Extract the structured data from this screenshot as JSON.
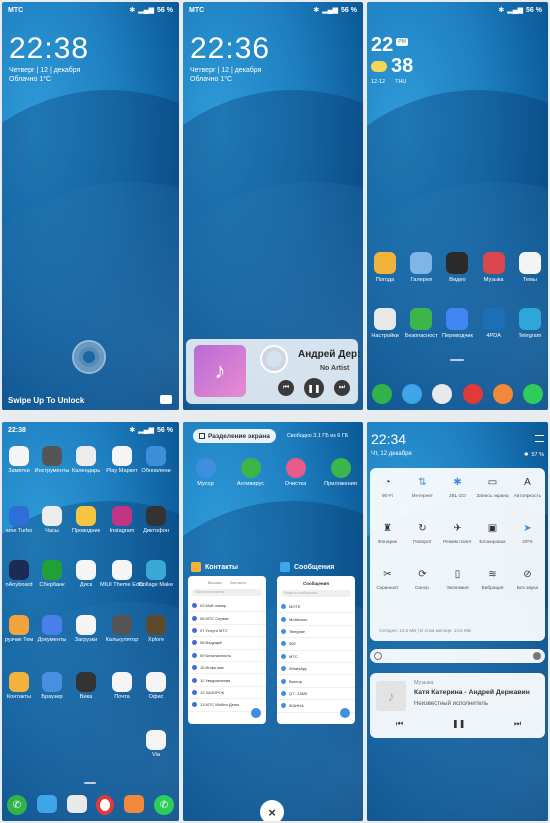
{
  "p1": {
    "carrier": "МТС",
    "battery": "56 %",
    "time": "22:38",
    "date": "Четверг | 12 | декабря",
    "weather": "Облачно 1°C",
    "hint": "Swipe Up To Unlock"
  },
  "p2": {
    "carrier": "МТС",
    "battery": "56 %",
    "time": "22:36",
    "date": "Четверг | 12 | декабря",
    "weather": "Облачно 1°C",
    "music_title": "Андрей Дер:",
    "music_artist": "No Artist"
  },
  "p3": {
    "battery": "56 %",
    "clock_h": "22",
    "clock_ampm": "PM",
    "clock_m": "38",
    "date": "12-12",
    "day": "THU",
    "row1": [
      {
        "label": "Погода",
        "icon": "weather-icon",
        "color": "#f2b33c"
      },
      {
        "label": "Галерея",
        "icon": "gallery-icon",
        "color": "#7fb6e8"
      },
      {
        "label": "Видео",
        "icon": "video-icon",
        "color": "#2a2a2a"
      },
      {
        "label": "Музыка",
        "icon": "music-icon",
        "color": "#d9464c"
      },
      {
        "label": "Темы",
        "icon": "themes-icon",
        "color": "#f4f4f4"
      }
    ],
    "row2": [
      {
        "label": "Настройки",
        "icon": "settings-icon",
        "color": "#e8e8e8"
      },
      {
        "label": "Безопасност",
        "icon": "security-icon",
        "color": "#3cb54a"
      },
      {
        "label": "Переводчик",
        "icon": "translate-icon",
        "color": "#4285f4"
      },
      {
        "label": "4PDA",
        "icon": "4pda-icon",
        "color": "#1b6fb5"
      },
      {
        "label": "Telegram",
        "icon": "telegram-icon",
        "color": "#2ea6da"
      }
    ],
    "dock": [
      {
        "icon": "phone-icon",
        "color": "#32b34a"
      },
      {
        "icon": "messages-icon",
        "color": "#3da5e8"
      },
      {
        "icon": "camera-icon",
        "color": "#e9e9e9"
      },
      {
        "icon": "opera-icon",
        "color": "#e03a3a"
      },
      {
        "icon": "mi-icon",
        "color": "#f2883a"
      },
      {
        "icon": "whatsapp-icon",
        "color": "#2ecc5b"
      }
    ]
  },
  "p4": {
    "time": "22:38",
    "battery": "56 %",
    "apps": [
      {
        "label": "Заметки",
        "color": "#f5f5f5"
      },
      {
        "label": "Инструменты",
        "color": "#555"
      },
      {
        "label": "Календарь",
        "color": "#ececec"
      },
      {
        "label": "Play Маркет",
        "color": "#f5f5f5"
      },
      {
        "label": "Обновлени",
        "color": "#3d8fd9"
      },
      {
        "label": "ame Turbo",
        "color": "#2d6fd6"
      },
      {
        "label": "Часы",
        "color": "#ececec"
      },
      {
        "label": "Проводник",
        "color": "#f5c440"
      },
      {
        "label": "Instagram",
        "color": "#c13584"
      },
      {
        "label": "Диктофон",
        "color": "#333"
      },
      {
        "label": "nAnyboard",
        "color": "#1d2a55"
      },
      {
        "label": "Сбербанк",
        "color": "#21a038"
      },
      {
        "label": "Диск",
        "color": "#f5f5f5"
      },
      {
        "label": "MIUI Theme Editor",
        "color": "#f5f5f5"
      },
      {
        "label": "Collage Make",
        "color": "#3aa7d6"
      },
      {
        "label": "рузчик Тем",
        "color": "#f2a33c"
      },
      {
        "label": "Документы",
        "color": "#4a7ee8"
      },
      {
        "label": "Загрузки",
        "color": "#f5f5f5"
      },
      {
        "label": "Калькулятор",
        "color": "#555"
      },
      {
        "label": "Xplore",
        "color": "#5c4a2e"
      },
      {
        "label": "Контакты",
        "color": "#f2b33c"
      },
      {
        "label": "Браузер",
        "color": "#4a90e2"
      },
      {
        "label": "Вика",
        "color": "#333"
      },
      {
        "label": "Почта",
        "color": "#f5f5f5"
      },
      {
        "label": "Офис",
        "color": "#f5f5f5"
      },
      {
        "label": "Via",
        "color": "#f5f5f5"
      }
    ]
  },
  "p5": {
    "split_label": "Разделение экрана",
    "memory": "Свободно 3.1 ГБ из 6 ГБ",
    "tools": [
      {
        "label": "Мусор",
        "icon": "trash-icon",
        "color": "#3f8fe0"
      },
      {
        "label": "Антивирус",
        "icon": "antivirus-icon",
        "color": "#3cb54a"
      },
      {
        "label": "Очистка",
        "icon": "cleaner-icon",
        "color": "#e85b8b"
      },
      {
        "label": "Приложения",
        "icon": "apps-icon",
        "color": "#3cb54a"
      }
    ],
    "card1_title": "Контакты",
    "card2_title": "Сообщения",
    "contacts_tabs": [
      "Вызовы",
      "Контакты"
    ],
    "contacts_search": "Поиск в контактах",
    "contacts": [
      "03 Мой номер",
      "06 МТС Сервис",
      "07 Услуги МТС",
      "08 Ведущий",
      "09 Безопасность",
      "10 Инфо мин",
      "11 Уведомления",
      "12 ЗАЗОРОК",
      "13 МТС Мобил Деньг"
    ],
    "sms_header": "Сообщения",
    "sms_search": "Поиск в сообщениях",
    "sms": [
      "МОТЕ",
      "Мобилист",
      "Telegram",
      "900",
      "МТС",
      "WhatsApp",
      "Виктор",
      "Q.Г. 23М0",
      "ЖАННА"
    ],
    "close_label": "×"
  },
  "p6": {
    "time": "22:34",
    "date": "Чт, 12 декабря",
    "battery": "57 %",
    "toggles": [
      {
        "label": "Wi-Fi",
        "icon": "wifi-icon"
      },
      {
        "label": "Интернет",
        "icon": "data-icon"
      },
      {
        "label": "JBL GO",
        "icon": "bluetooth-icon"
      },
      {
        "label": "Запись экрана",
        "icon": "record-icon"
      },
      {
        "label": "Автояркость",
        "icon": "brightness-auto-icon"
      },
      {
        "label": "Фонарик",
        "icon": "flashlight-icon"
      },
      {
        "label": "Поворот",
        "icon": "rotate-icon"
      },
      {
        "label": "Режим полет",
        "icon": "airplane-icon"
      },
      {
        "label": "Блокировка",
        "icon": "lock-icon"
      },
      {
        "label": "GPS",
        "icon": "gps-icon"
      },
      {
        "label": "Скриншот",
        "icon": "screenshot-icon"
      },
      {
        "label": "Синхр.",
        "icon": "sync-icon"
      },
      {
        "label": "Экономия",
        "icon": "battery-saver-icon"
      },
      {
        "label": "Вибрация",
        "icon": "vibrate-icon"
      },
      {
        "label": "Без звука",
        "icon": "mute-icon"
      }
    ],
    "data_usage": "Сегодня: 14.5 МБ | В этом месяце: 14.5 МБ",
    "music_app": "Музыка",
    "music_title": "Катя  Катерина - Андрей Державин",
    "music_artist": "Неизвестный исполнитель"
  }
}
